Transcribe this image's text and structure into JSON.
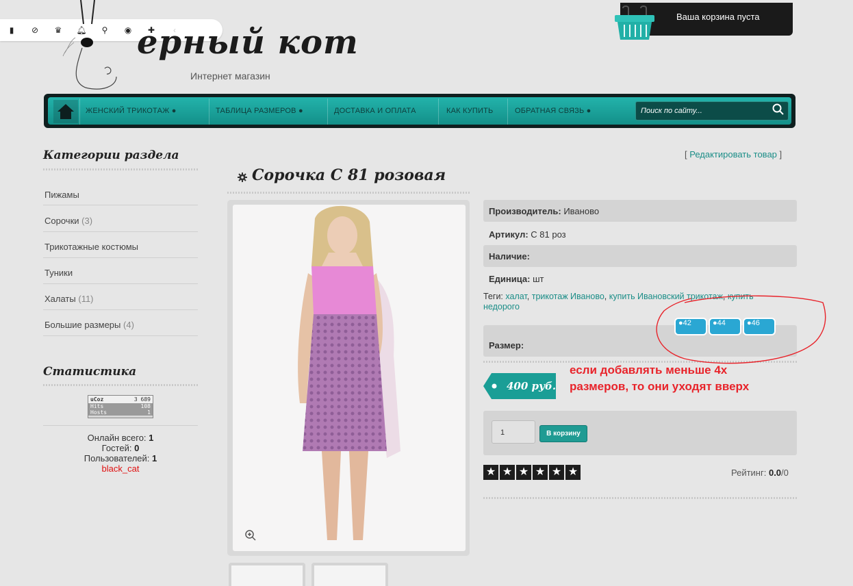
{
  "toolbar": {
    "icons": [
      "menu-icon",
      "block-icon",
      "crown-icon",
      "bell-icon",
      "search-icon",
      "eye-icon",
      "puzzle-icon",
      "chevron-left-icon"
    ]
  },
  "logo": {
    "title": "ерный кот",
    "subtitle": "Интернет магазин"
  },
  "cart": {
    "status": "Ваша корзина пуста"
  },
  "nav": {
    "items": [
      {
        "label": "ЖЕНСКИЙ ТРИКОТАЖ",
        "dropdown": true
      },
      {
        "label": "ТАБЛИЦА РАЗМЕРОВ",
        "dropdown": true
      },
      {
        "label": "ДОСТАВКА И ОПЛАТА",
        "dropdown": false
      },
      {
        "label": "КАК КУПИТЬ",
        "dropdown": false
      },
      {
        "label": "ОБРАТНАЯ СВЯЗЬ",
        "dropdown": true
      }
    ],
    "search_placeholder": "Поиск по сайту..."
  },
  "sidebar": {
    "categories_title": "Категории раздела",
    "categories": [
      {
        "label": "Пижамы",
        "count": ""
      },
      {
        "label": "Сорочки",
        "count": "(3)"
      },
      {
        "label": "Трикотажные костюмы",
        "count": ""
      },
      {
        "label": "Туники",
        "count": ""
      },
      {
        "label": "Халаты",
        "count": "(11)"
      },
      {
        "label": "Большие размеры",
        "count": "(4)"
      }
    ],
    "stats_title": "Статистика",
    "counter": {
      "brand": "uCoz",
      "total": "3 689",
      "hits_label": "Hits",
      "hits": "108",
      "hosts_label": "Hosts",
      "hosts": "1"
    },
    "online": {
      "total_label": "Онлайн всего:",
      "total": "1",
      "guests_label": "Гостей:",
      "guests": "0",
      "users_label": "Пользователей:",
      "users": "1",
      "user_name": "black_cat"
    }
  },
  "product": {
    "edit_link": "Редактировать товар",
    "title": "Сорочка С 81 розовая",
    "manufacturer_label": "Производитель:",
    "manufacturer": "Иваново",
    "article_label": "Артикул:",
    "article": "С 81 роз",
    "availability_label": "Наличие:",
    "unit_label": "Единица:",
    "unit": "шт",
    "tags_label": "Теги:",
    "tags": [
      "халат",
      "трикотаж Иваново",
      "купить Ивановский трикотаж",
      "купить недорого"
    ],
    "size_label": "Размер:",
    "sizes": [
      "42",
      "44",
      "46"
    ],
    "price": "400 руб.",
    "quantity": "1",
    "add_to_cart": "В корзину",
    "rating_label": "Рейтинг:",
    "rating_value": "0.0",
    "rating_count": "/0",
    "stars": 5
  },
  "annotation": {
    "line1": "если добавлять меньше 4х",
    "line2": "размеров, то они уходят вверх"
  },
  "colors": {
    "accent": "#1a9e96",
    "annotation": "#e8232a",
    "dark": "#1a1a1a"
  }
}
